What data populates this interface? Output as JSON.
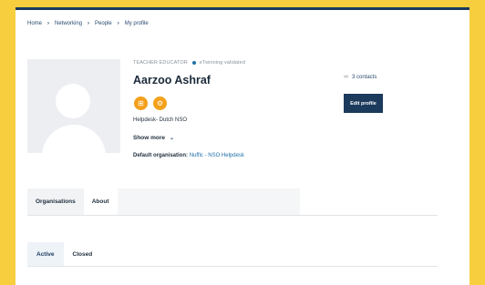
{
  "breadcrumb": [
    "Home",
    "Networking",
    "People",
    "My profile"
  ],
  "breadcrumb_separator": "›",
  "profile": {
    "role": "TEACHER EDUCATOR",
    "validated": "eTwinning validated",
    "name": "Aarzoo Ashraf",
    "badge_icons": [
      "book-icon",
      "gear-icon"
    ],
    "badge_glyphs": [
      "⊞",
      "⚙"
    ],
    "organisation_text": "Helpdesk- Dutch NSO",
    "show_more": "Show more",
    "show_more_chevron": "⌄",
    "default_org_label": "Default organisation:",
    "default_org_value": "Nuffic - NSO Helpdesk",
    "contacts": "3 contacts",
    "contacts_icon": "∞",
    "edit_button": "Edit profile"
  },
  "tabs_primary": [
    "Organisations",
    "About"
  ],
  "tabs_secondary": [
    "Active",
    "Closed"
  ],
  "colors": {
    "background": "#f7cf3e",
    "primary": "#1b3a5c",
    "badge": "#f4a01b",
    "link": "#1f6fa8"
  }
}
